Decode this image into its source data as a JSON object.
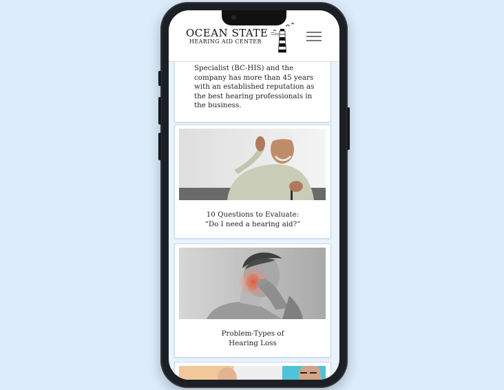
{
  "header": {
    "logo_name": "OCEAN STATE",
    "logo_sub": "HEARING AID CENTER",
    "menu_icon": "hamburger-menu-icon"
  },
  "intro": {
    "text": "Specialist (BC-HIS) and the company has more than 45 years with an established reputation as the best hearing professionals in the business."
  },
  "articles": [
    {
      "line1": "10 Questions to Evaluate:",
      "line2": "“Do I need a hearing aid?”"
    },
    {
      "line1": "Problem-Types of",
      "line2": "Hearing Loss"
    }
  ],
  "colors": {
    "background": "#dcecfb",
    "phone_frame": "#1c1f24",
    "card": "#ffffff",
    "accent_red": "#e8533a"
  }
}
